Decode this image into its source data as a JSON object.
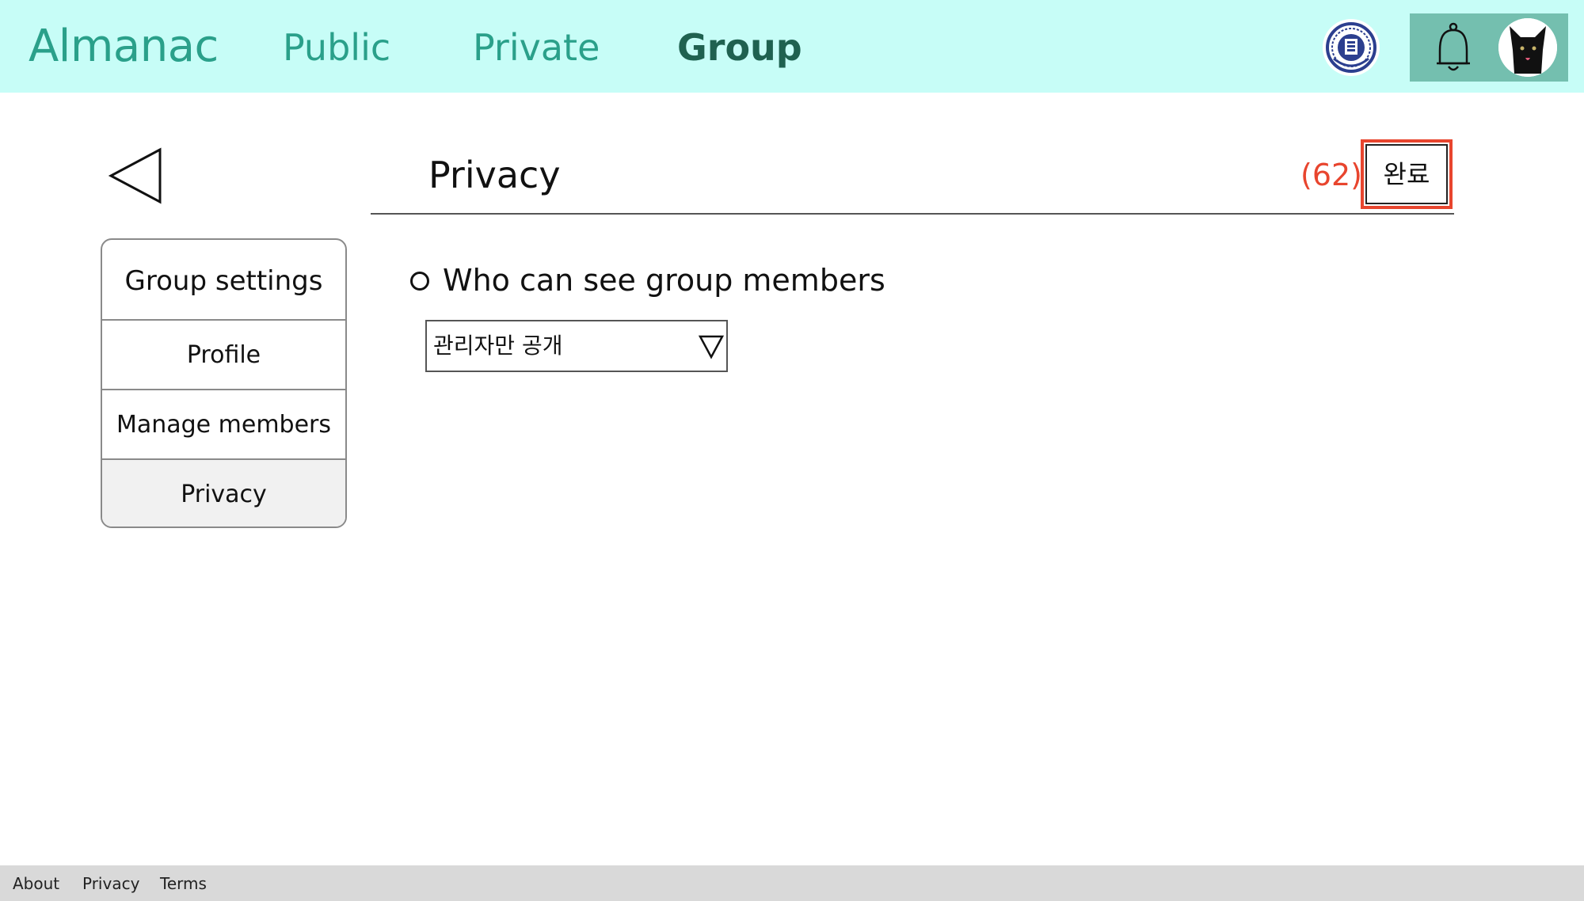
{
  "app": {
    "logo": "Almanac"
  },
  "nav": {
    "items": [
      {
        "label": "Public",
        "active": false
      },
      {
        "label": "Private",
        "active": false
      },
      {
        "label": "Group",
        "active": true
      }
    ]
  },
  "header_icons": {
    "org_badge": "university-seal-icon",
    "notifications": "bell-icon",
    "avatar": "black-cat-avatar"
  },
  "sidebar": {
    "title": "Group settings",
    "items": [
      {
        "label": "Profile",
        "selected": false
      },
      {
        "label": "Manage members",
        "selected": false
      },
      {
        "label": "Privacy",
        "selected": true
      }
    ]
  },
  "main": {
    "back_icon": "back-triangle-icon",
    "title": "Privacy",
    "annotation_count": "(62)",
    "done_label": "완료",
    "setting": {
      "label": "Who can see group members",
      "selected_value": "관리자만 공개"
    }
  },
  "footer": {
    "links": [
      "About",
      "Privacy",
      "Terms"
    ]
  },
  "colors": {
    "topbar_bg": "#c7fdf7",
    "nav_accent": "#2aa08a",
    "nav_active": "#1f6150",
    "user_panel_bg": "#74bfaf",
    "highlight": "#e8452e",
    "footer_bg": "#d9d9d9"
  }
}
